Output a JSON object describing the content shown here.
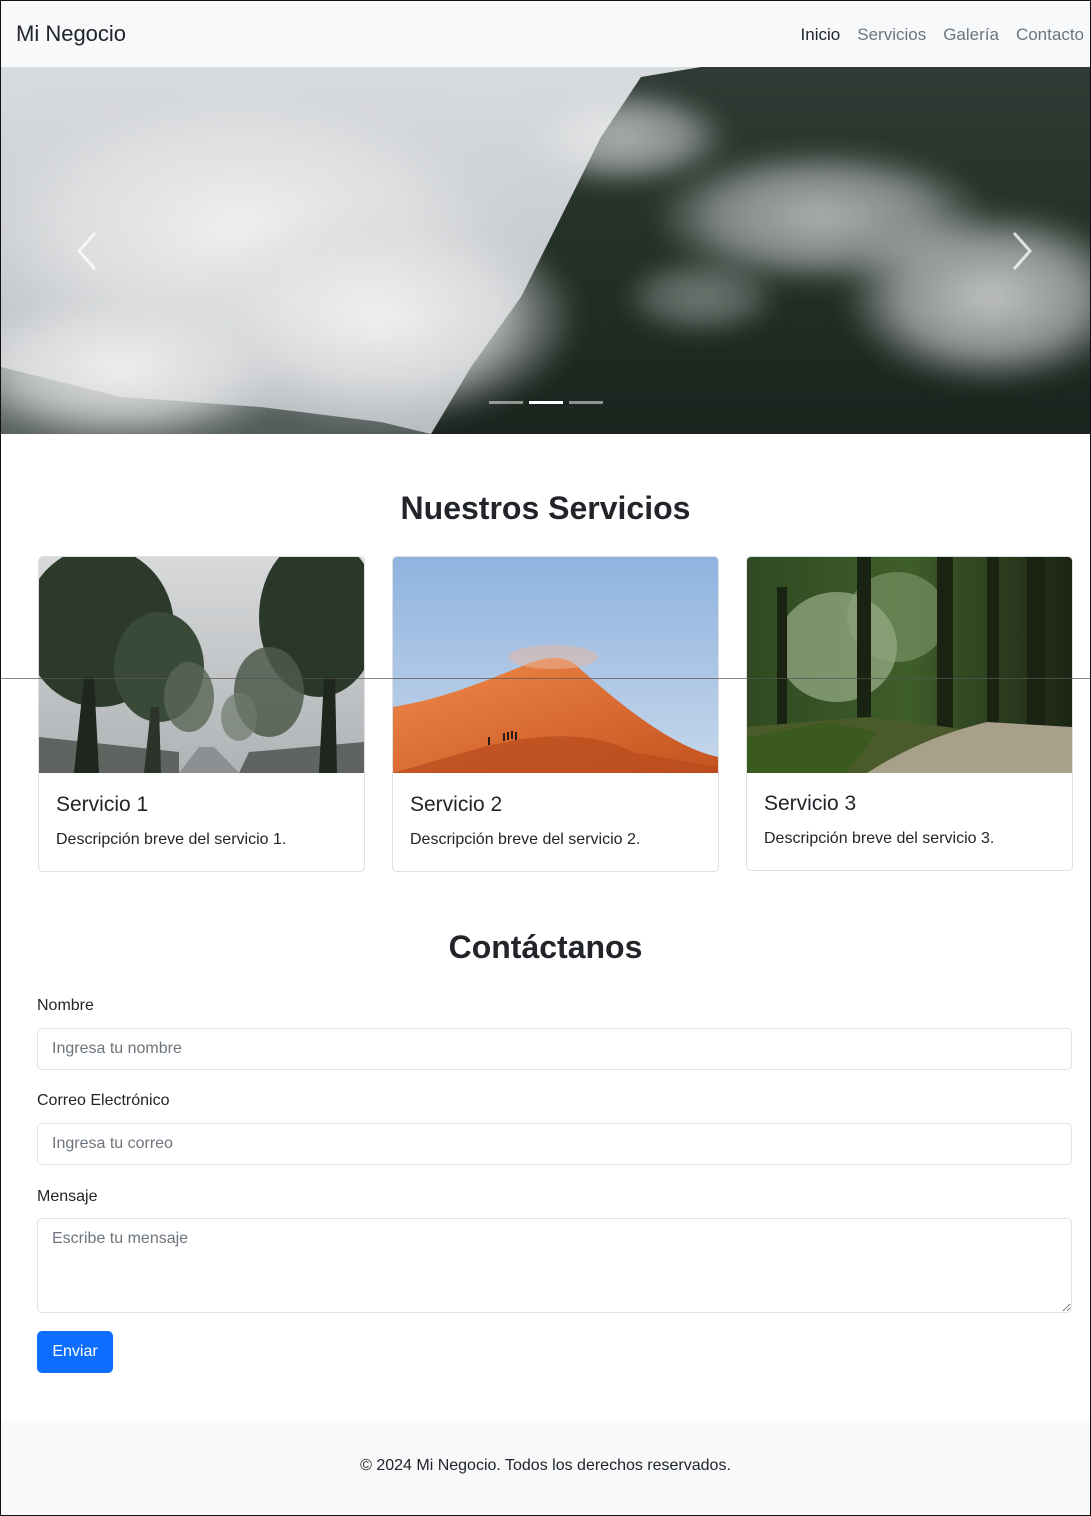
{
  "navbar": {
    "brand": "Mi Negocio",
    "links": [
      {
        "label": "Inicio",
        "active": true
      },
      {
        "label": "Servicios",
        "active": false
      },
      {
        "label": "Galería",
        "active": false
      },
      {
        "label": "Contacto",
        "active": false
      }
    ]
  },
  "carousel": {
    "slide_count": 3,
    "active_index": 1,
    "prev_icon": "chevron-left-icon",
    "next_icon": "chevron-right-icon"
  },
  "services": {
    "title": "Nuestros Servicios",
    "cards": [
      {
        "title": "Servicio 1",
        "text": "Descripción breve del servicio 1."
      },
      {
        "title": "Servicio 2",
        "text": "Descripción breve del servicio 2."
      },
      {
        "title": "Servicio 3",
        "text": "Descripción breve del servicio 3."
      }
    ]
  },
  "contact": {
    "title": "Contáctanos",
    "name_label": "Nombre",
    "name_placeholder": "Ingresa tu nombre",
    "email_label": "Correo Electrónico",
    "email_placeholder": "Ingresa tu correo",
    "message_label": "Mensaje",
    "message_placeholder": "Escribe tu mensaje",
    "submit_label": "Enviar"
  },
  "footer": {
    "text": "© 2024 Mi Negocio. Todos los derechos reservados."
  },
  "colors": {
    "primary": "#0d6efd",
    "navbar_bg": "#f8f9fa",
    "muted_link": "#6c757d"
  }
}
